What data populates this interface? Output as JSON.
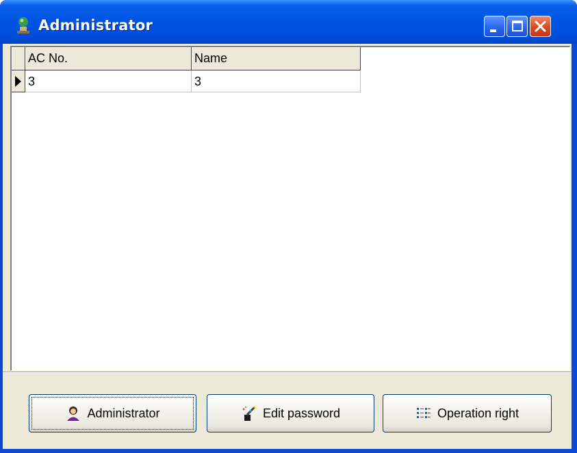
{
  "window": {
    "title": "Administrator",
    "app_icon": "user-globe-icon",
    "controls": {
      "minimize": "minimize-icon",
      "maximize": "maximize-icon",
      "close": "close-icon"
    }
  },
  "grid": {
    "columns": [
      "AC No.",
      "Name"
    ],
    "rows": [
      {
        "ac_no": "3",
        "name": "3",
        "current": true
      }
    ]
  },
  "buttons": {
    "administrator": {
      "label": "Administrator",
      "icon": "administrator-icon"
    },
    "edit_password": {
      "label": "Edit password",
      "icon": "magic-wand-icon"
    },
    "operation_right": {
      "label": "Operation right",
      "icon": "permissions-list-icon"
    }
  },
  "colors": {
    "titlebar": "#0054e3",
    "client": "#ece9d8",
    "close": "#d84a22"
  }
}
